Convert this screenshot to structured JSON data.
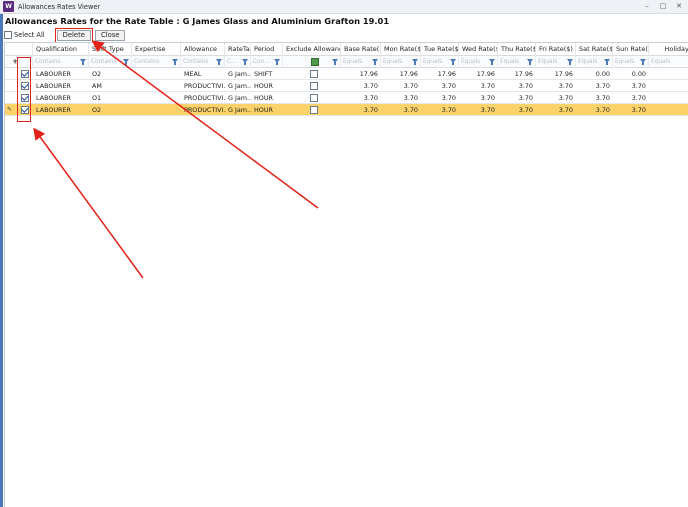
{
  "window": {
    "title": "Allowances Rates Viewer",
    "icon_text": "W"
  },
  "page": {
    "heading": "Allowances Rates for the Rate Table : G James Glass and Aluminium Grafton 19.01"
  },
  "toolbar": {
    "select_all_label": "Select All",
    "delete_label": "Delete",
    "close_label": "Close"
  },
  "columns": {
    "qualification": "Qualification",
    "shift_type": "Shift Type",
    "expertise": "Expertise",
    "allowance": "Allowance",
    "rate_table": "RateTa...",
    "period": "Period",
    "exclude_allowance": "Exclude Allowance",
    "base_rate": "Base Rate($)",
    "mon_rate": "Mon Rate($)",
    "tue_rate": "Tue Rate($)",
    "wed_rate": "Wed Rate($)",
    "thu_rate": "Thu Rate($)",
    "fri_rate": "Fri Rate($)",
    "sat_rate": "Sat Rate($)",
    "sun_rate": "Sun Rate($)",
    "holiday": "Holiday We"
  },
  "filters": {
    "contains": "Contains",
    "contains_short": "C...",
    "contains_mid": "Con...",
    "equals": "Equals"
  },
  "rows": [
    {
      "checked": true,
      "qualification": "LABOURER",
      "shift_type": "O2",
      "expertise": "",
      "allowance": "MEAL",
      "rate_table": "G Jam...",
      "period": "SHIFT",
      "exclude": false,
      "base": "17.96",
      "mon": "17.96",
      "tue": "17.96",
      "wed": "17.96",
      "thu": "17.96",
      "fri": "17.96",
      "sat": "0.00",
      "sun": "0.00",
      "selected": false
    },
    {
      "checked": true,
      "qualification": "LABOURER",
      "shift_type": "AM",
      "expertise": "",
      "allowance": "PRODUCTIVI...",
      "rate_table": "G Jam...",
      "period": "HOUR",
      "exclude": false,
      "base": "3.70",
      "mon": "3.70",
      "tue": "3.70",
      "wed": "3.70",
      "thu": "3.70",
      "fri": "3.70",
      "sat": "3.70",
      "sun": "3.70",
      "selected": false
    },
    {
      "checked": true,
      "qualification": "LABOURER",
      "shift_type": "O1",
      "expertise": "",
      "allowance": "PRODUCTIVI...",
      "rate_table": "G Jam...",
      "period": "HOUR",
      "exclude": false,
      "base": "3.70",
      "mon": "3.70",
      "tue": "3.70",
      "wed": "3.70",
      "thu": "3.70",
      "fri": "3.70",
      "sat": "3.70",
      "sun": "3.70",
      "selected": false
    },
    {
      "checked": true,
      "qualification": "LABOURER",
      "shift_type": "O2",
      "expertise": "",
      "allowance": "PRODUCTIVI...",
      "rate_table": "G Jam...",
      "period": "HOUR",
      "exclude": false,
      "base": "3.70",
      "mon": "3.70",
      "tue": "3.70",
      "wed": "3.70",
      "thu": "3.70",
      "fri": "3.70",
      "sat": "3.70",
      "sun": "3.70",
      "selected": true
    }
  ],
  "colors": {
    "selected_row": "#fbd36a",
    "annotation": "#e2231a",
    "accent": "#4a78b8"
  },
  "icons": {
    "app": "app-logo-icon",
    "filter": "filter-funnel-icon",
    "row_pointer": "row-edit-pencil-icon"
  }
}
